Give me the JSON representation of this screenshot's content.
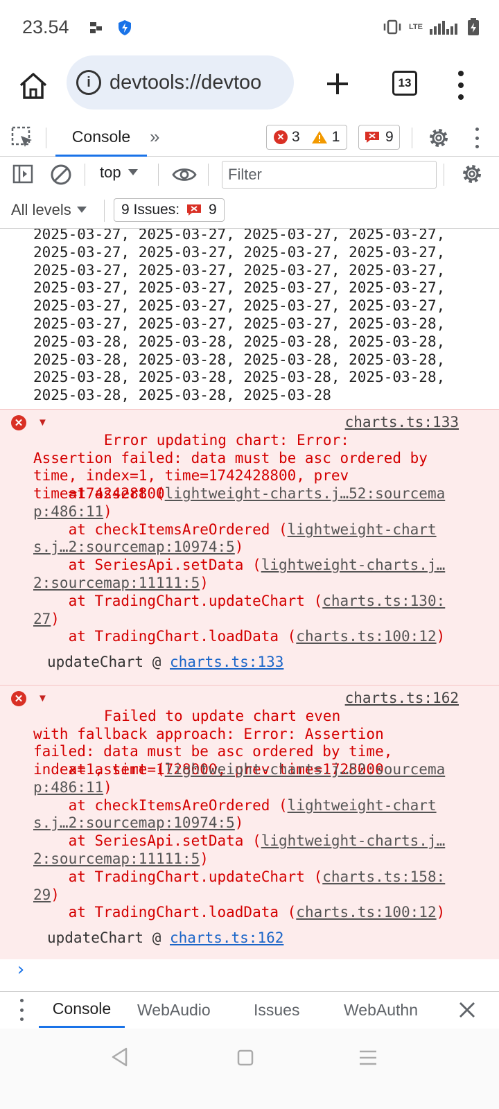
{
  "status_bar": {
    "time": "23.54",
    "network": "LTE"
  },
  "browser": {
    "url": "devtools://devtoo",
    "tab_count": "13"
  },
  "devtools": {
    "main_tab": "Console",
    "more_tabs": "»",
    "errors_count": "3",
    "warnings_count": "1",
    "issues_count": "9"
  },
  "console_toolbar": {
    "context": "top",
    "filter_placeholder": "Filter",
    "levels": "All levels",
    "issues_label": "9 Issues:",
    "issues_badge": "9"
  },
  "output": {
    "date_lines": "2025-03-27, 2025-03-27, 2025-03-27, 2025-03-27,\n2025-03-27, 2025-03-27, 2025-03-27, 2025-03-27,\n2025-03-27, 2025-03-27, 2025-03-27, 2025-03-27,\n2025-03-27, 2025-03-27, 2025-03-27, 2025-03-27,\n2025-03-27, 2025-03-27, 2025-03-27, 2025-03-27,\n2025-03-27, 2025-03-27, 2025-03-27, 2025-03-28,\n2025-03-28, 2025-03-28, 2025-03-28, 2025-03-28,\n2025-03-28, 2025-03-28, 2025-03-28, 2025-03-28,\n2025-03-28, 2025-03-28, 2025-03-28, 2025-03-28,\n2025-03-28, 2025-03-28, 2025-03-28",
    "error1": {
      "source": "charts.ts:133",
      "message": "Error updating chart: Error:\nAssertion failed: data must be asc ordered by\ntime, index=1, time=1742428800, prev\ntime=1742428800",
      "stack": [
        {
          "prefix": "    at assert (",
          "link": "lightweight-charts.j…52:sourcema",
          "cont": "p:486:11",
          "suffix": ")"
        },
        {
          "prefix": "    at checkItemsAreOrdered (",
          "link": "lightweight-chart",
          "cont": "s.j…2:sourcemap:10974:5",
          "suffix": ")"
        },
        {
          "prefix": "    at SeriesApi.setData (",
          "link": "lightweight-charts.j…",
          "cont": "2:sourcemap:11111:5",
          "suffix": ")"
        },
        {
          "prefix": "    at TradingChart.updateChart (",
          "link": "charts.ts:130:",
          "cont": "27",
          "suffix": ")"
        },
        {
          "prefix": "    at TradingChart.loadData (",
          "link": "charts.ts:100:12",
          "cont": "",
          "suffix": ")"
        }
      ],
      "caller": "updateChart @ ",
      "caller_link": "charts.ts:133"
    },
    "error2": {
      "source": "charts.ts:162",
      "message": "Failed to update chart even\nwith fallback approach: Error: Assertion\nfailed: data must be asc ordered by time,\nindex=1, time=1728000, prev time=1728000",
      "stack": [
        {
          "prefix": "    at assert (",
          "link": "lightweight-charts.j…52:sourcema",
          "cont": "p:486:11",
          "suffix": ")"
        },
        {
          "prefix": "    at checkItemsAreOrdered (",
          "link": "lightweight-chart",
          "cont": "s.j…2:sourcemap:10974:5",
          "suffix": ")"
        },
        {
          "prefix": "    at SeriesApi.setData (",
          "link": "lightweight-charts.j…",
          "cont": "2:sourcemap:11111:5",
          "suffix": ")"
        },
        {
          "prefix": "    at TradingChart.updateChart (",
          "link": "charts.ts:158:",
          "cont": "29",
          "suffix": ")"
        },
        {
          "prefix": "    at TradingChart.loadData (",
          "link": "charts.ts:100:12",
          "cont": "",
          "suffix": ")"
        }
      ],
      "caller": "updateChart @ ",
      "caller_link": "charts.ts:162"
    },
    "prompt": "›"
  },
  "drawer": {
    "tabs": [
      "Console",
      "WebAudio",
      "Issues",
      "WebAuthn"
    ]
  },
  "colors": {
    "error": "#d40000",
    "error_bg": "#fdecec",
    "accent": "#1a73e8",
    "warning": "#f29900"
  }
}
